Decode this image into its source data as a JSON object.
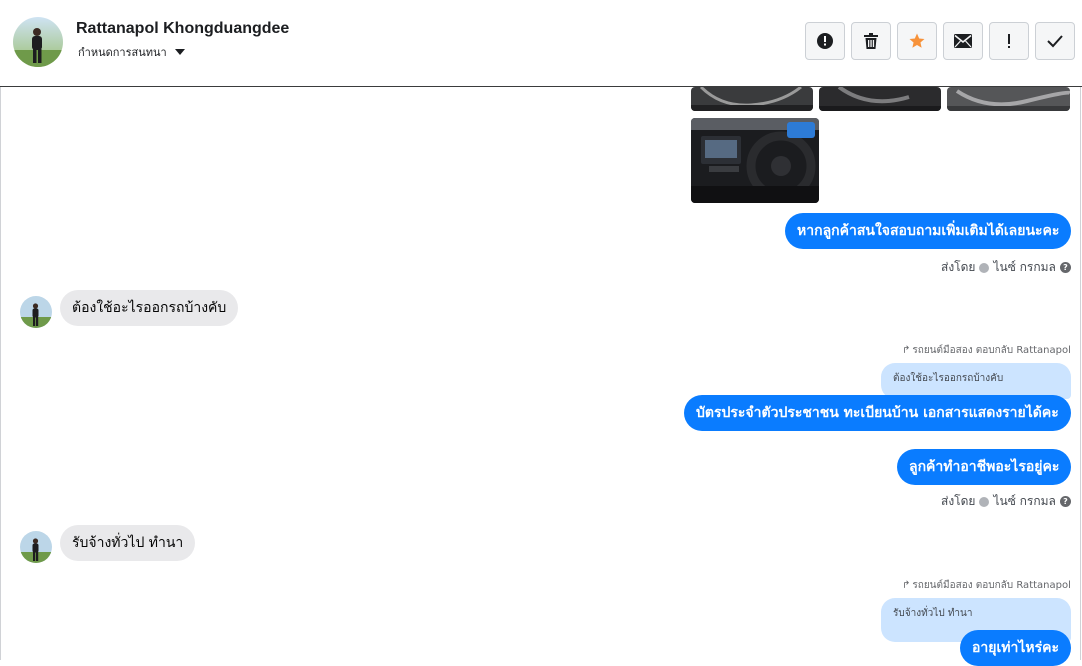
{
  "header": {
    "contact_name": "Rattanapol Khongduangdee",
    "settings_label": "กำหนดการสนทนา",
    "toolbar": [
      {
        "name": "alert-circle-icon",
        "label": "Mark as spam"
      },
      {
        "name": "trash-icon",
        "label": "Delete"
      },
      {
        "name": "star-icon",
        "label": "Star"
      },
      {
        "name": "envelope-icon",
        "label": "Mark unread"
      },
      {
        "name": "exclamation-icon",
        "label": "Follow up"
      },
      {
        "name": "check-icon",
        "label": "Done"
      }
    ]
  },
  "messages": {
    "out_1": "หากลูกค้าสนใจสอบถามเพิ่มเติมได้เลยนะคะ",
    "sent_by_1": {
      "prefix": "ส่งโดย",
      "name": "ไนซ์ กรกมล"
    },
    "in_1": "ต้องใช้อะไรออกรถบ้างคับ",
    "reply_header_1": "รถยนต์มือสอง ตอบกลับ Rattanapol",
    "quote_1": "ต้องใช้อะไรออกรถบ้างคับ",
    "out_2": "บัตรประจำตัวประชาชน ทะเบียนบ้าน เอกสารแสดงรายได้คะ",
    "out_3": "ลูกค้าทำอาชีพอะไรอยู่คะ",
    "sent_by_2": {
      "prefix": "ส่งโดย",
      "name": "ไนซ์ กรกมล"
    },
    "in_2": "รับจ้างทั่วไป ทำนา",
    "reply_header_2": "รถยนต์มือสอง ตอบกลับ Rattanapol",
    "quote_2": "รับจ้างทั่วไป ทำนา",
    "out_4": "อายุเท่าไหร่คะ"
  },
  "colors": {
    "outgoing_bubble": "#0a7cff",
    "incoming_bubble": "#e9e9eb",
    "quote_bubble": "#cce4ff",
    "star_accent": "#f7923a"
  }
}
